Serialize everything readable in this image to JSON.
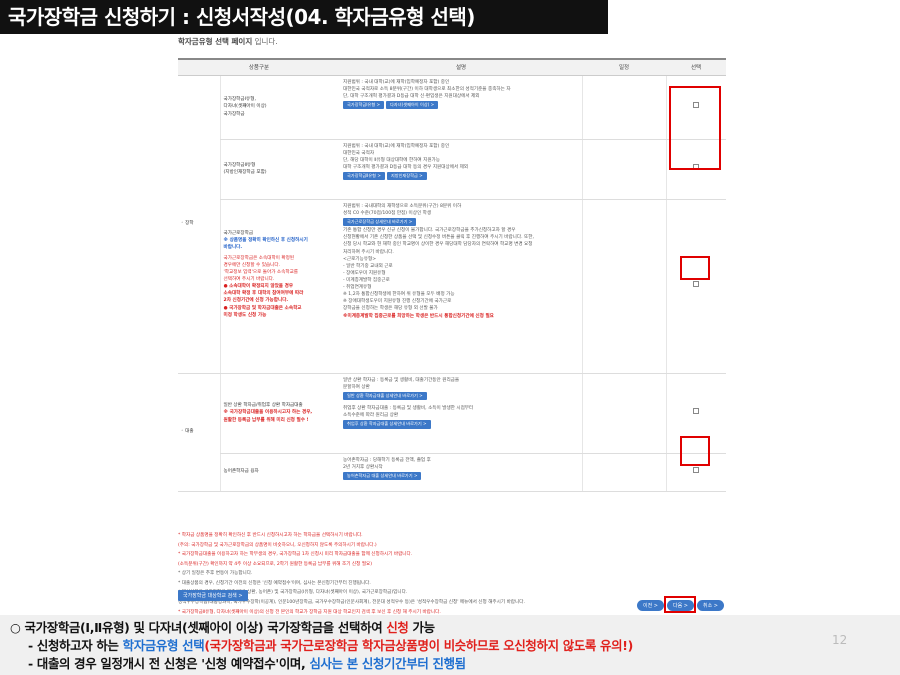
{
  "header": {
    "title": "국가장학금 신청하기 : 신청서작성(04. 학자금유형 선택)"
  },
  "page_caption": {
    "bold": "학자금유형 선택 페이지",
    "rest": " 입니다."
  },
  "table": {
    "headers": [
      "상품구분",
      "설명",
      "일정",
      "선택"
    ],
    "categories": {
      "scholarship": "◦ 장학",
      "loan": "◦ 대출"
    },
    "rows": [
      {
        "type_lines": [
          "국가장학금Ⅰ유형,",
          "다자녀(셋째아이 이상)",
          "국가장학금"
        ],
        "desc_lines": [
          "지원범위 : 국내 대학(교)에 재학(입학예정자 포함) 중인",
          "대한민국 국적자로 소득 8분위(구간) 이하 대학생으로 최소한의 성적기준을 충족하는 자",
          "단, 대학 구조개혁 평가결과 D등급 대학 신·편입생은 지원대상에서 제외"
        ],
        "buttons": [
          "국가장학금Ⅰ유형 >",
          "다자녀(셋째아이 이상) >"
        ]
      },
      {
        "type_lines": [
          "국가장학금Ⅱ유형",
          "(지방인재장학금 포함)"
        ],
        "desc_lines": [
          "지원범위 : 국내 대학(교)에 재학(입학예정자 포함) 중인",
          "대한민국 국적자",
          "단, 해당 대학이 Ⅱ유형 대상대학에 한하여 지원가능",
          "대학 구조개혁 평가결과 D등급 대학 등의 경우 지원대상에서 제외"
        ],
        "buttons": [
          "국가장학금Ⅱ유형 >",
          "지방인재장학금 >"
        ]
      },
      {
        "type_lines": [
          "국가근로장학금"
        ],
        "type_blue": [
          "※ 상품명을 정확히 확인하신 후 신청하시기",
          "바랍니다."
        ],
        "type_red": [
          "국가근로장학금은 소속대학이 확정된",
          "경우에만 신청할 수 있습니다.",
          "'학교정보 입력'으로 돌아가 소속학교를",
          "선택하여 주시기 바랍니다.",
          "● 소속대학이 확정되지 않았을 경우",
          "소속대학 확정 후 대학의 참여여부에 따라",
          "2차 신청기간에 신청 가능합니다.",
          "● 국가장학금 및 학자금대출은 소속학교",
          "미정 학생도 신청 가능"
        ],
        "desc_lines": [
          "지원범위 : 국내대학의 재학생으로 소득분위(구간) 8분위 이하",
          "성적 C0 수준(70점/100점 만점) 이상인 학생"
        ],
        "button": "국가근로장학금 상세안내 바로가기 >",
        "desc_lines2": [
          "기존 통합 신청만 경우 신규 신청이 불가합니다. 국가근로장학금을 추가신청하고자 할 경우",
          "신청현황에서 기존 신청한 상품을 선택 및 신청수정 버튼을 클릭 후 진행하여 주시기 바랍니다. 또한,",
          "신청 당시 학교와 현 재학 중인 학교명이 상이한 경우 해당대학 담당자의 연락하여 학교명 변경 요청",
          "처리하여 주시기 바랍니다.",
          "<근로기능유형>",
          "- 일반 학기중 교내외 근로",
          "- 장애도우미 지원유형",
          "- 미계층계발학 집중근로",
          "- 취업연계유형",
          "※ 1,2차 통합신청학생에 한하여 위 유형을 모두 배정 가능",
          "※ 장애대학생도우미 지원유형 진행 신청기간에 국가근로",
          "   장학금을 신청하는 학생은 해당 유형 외 선발 불가"
        ],
        "desc_note": "※미계층계발학 집중근로를 희망하는 학생은 반드시 통합신청기간에 신청 필요"
      },
      {
        "type_lines": [
          "일반 상환 학자금/취업후 상환 학자금대출"
        ],
        "type_red": [
          "※ 국가장학금대출을 이용하시고자 하는 경우,",
          "원활한 등록금 납부를 위해 미리 신청 필수 !"
        ],
        "desc_lines": [
          "일반 상환 학자금 : 등록금 및 생활비, 대출기간동안 원리금을",
          "분할하여 상환"
        ],
        "button": "일반 상환 학자금대출 상세안내 바로가기 >",
        "desc_lines2": [
          "취업후 상환 학자금대출 : 등록금 및 생활비, 소득이 발생한 시점부터",
          "소득수준에 따라 원리금 상환"
        ],
        "button2": "취업후 상환 학자금대출 상세안내 바로가기 >"
      },
      {
        "type_lines": [
          "농어촌학자금 융자"
        ],
        "desc_lines": [
          "농어촌학자금 : 당해학기 등록금 전액, 졸업 후",
          "2년 거치후 상환시작"
        ],
        "button": "농어촌학자금 대출 상세안내 바로가기 >"
      }
    ]
  },
  "notes": [
    "* 학자금 상품명을 정확히 확인하신 후 반드시 신청하시고자 하는 학자금을 선택하시기 바랍니다.",
    "  (주의: 국가장학금 및 국가근로장학금의 상품명이 비슷하오니, 오신청하지 않도록 주의하시기 바랍니다.)",
    "* 국가장학금대출을 이용하고자 하는 학부생의 경우, 국가장학금 1차 신청시 미리 학자금대출을 함께 신청하시기 바랍니다.",
    "  (소득분위(구간) 확인까지 약 4주 이상 소요되므로, 2학기 원활한 등록금 납부를 위해 조기 신청 필요)",
    "* 상기 일정은 추후 변동이 가능합니다.",
    "* 대출상품의 경우, 신청기간 이전의 신청은 '신청 예약접수'이며, 심사는 본신청기간부터 진행됩니다.",
    "* 대상상품은 국가장학금 대출(일반 상환, 농어촌) 및 국가장학금(Ⅰ유형, 다자녀(셋째아이 이상), 국가근로장학금)입니다.",
    "  성적우수장학금(대통령과학, 국가우수장학(이공계), 인문100년장학금, 국가우수장학금(인문사회계), 전문대 성적우수 등)은 '성적우수장학금 신청' 메뉴에서 신청 해주시기 바랍니다.",
    "* 국가장학금Ⅱ유형, 다자녀(셋째아이 이상)의 신청 전 본인의 학교가 장학금 지원 대상 학교인지 검색 후 보신 후 신청 해 주시기 바랍니다."
  ],
  "eligible_button": "국가장학금 대상학교 검색 >",
  "nav": {
    "prev": "이전 >",
    "next": "다음 >",
    "cancel": "취소 >"
  },
  "bottom": {
    "l1_a": "○ 국가장학금(Ⅰ,Ⅱ유형) 및 다자녀(셋째아이 이상) 국가장학금을 선택하여 ",
    "l1_b": "신청",
    "l1_c": " 가능",
    "l2_a": "- 신청하고자 하는 ",
    "l2_b": "학자금유형 선택",
    "l2_c": "(국가장학금과 국가근로장학금 학자금상품명이 비슷하므로 오신청하지 않도록 유의!)",
    "l3_a": "- 대출의 경우 일정개시 전 신청은 '신청 예약접수'이며, ",
    "l3_b": "심사는 본 신청기간부터 진행됨",
    "page": "12"
  }
}
